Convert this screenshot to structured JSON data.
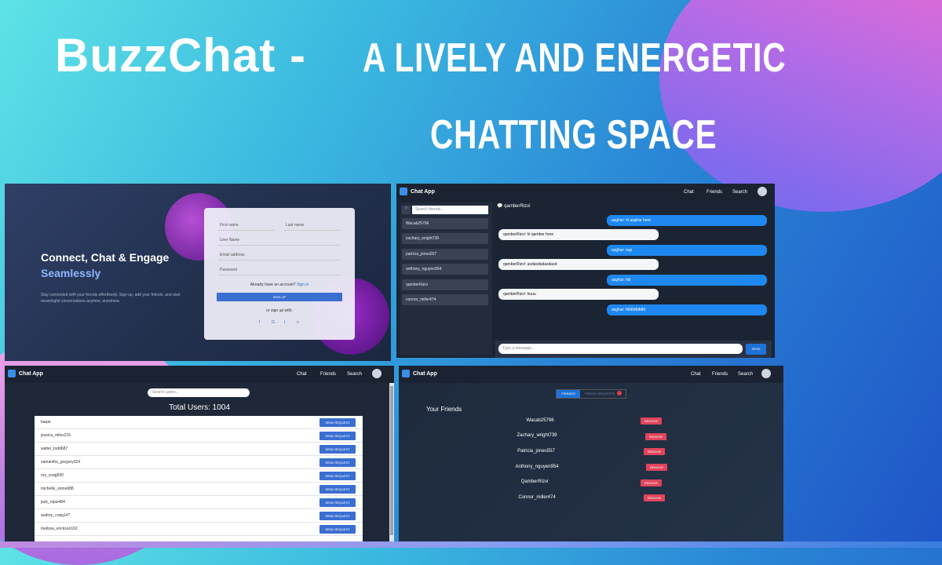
{
  "hero": {
    "brand": "BuzzChat  -",
    "line1": "A LIVELY AND ENERGETIC",
    "line2": "CHATTING SPACE"
  },
  "signup": {
    "heading": "Connect, Chat & Engage",
    "subheading": "Seamlessly",
    "description": "Stay connected with your friends effortlessly. Sign up, add your friends, and start meaningful conversations anytime, anywhere.",
    "first_name": "First name",
    "last_name": "Last name",
    "username": "User Name",
    "email": "Email address",
    "password": "Password",
    "account_prompt": "Already have an account?",
    "sign_in": "Sign in",
    "signup_button": "SIGN UP",
    "or_sign_up": "or sign up with:",
    "social_icons": [
      "facebook-icon",
      "google-icon",
      "twitter-icon",
      "github-icon"
    ]
  },
  "nav": {
    "brand": "Chat App",
    "chat": "Chat",
    "friends": "Friends",
    "search": "Search"
  },
  "chat": {
    "search_placeholder": "Search friends...",
    "friends": [
      "Wacab25796",
      "zachary_wright739",
      "patricia_jones557",
      "anthony_nguyen954",
      "qamberRizvi",
      "connor_miller474"
    ],
    "header": "qamberRizvi",
    "messages": [
      {
        "side": "right",
        "text": "asghar: hi asghar here"
      },
      {
        "side": "left",
        "text": "qamberRizvi: hi qamber here"
      },
      {
        "side": "right",
        "text": "asghar: sup"
      },
      {
        "side": "left",
        "text": "qamberRizvi: asdasdadasdasd"
      },
      {
        "side": "right",
        "text": "asghar: hiii"
      },
      {
        "side": "left",
        "text": "qamberRizvi: huuu"
      },
      {
        "side": "right",
        "text": "asghar: fdfdfdfdfdfd"
      }
    ],
    "input_placeholder": "Type a message...",
    "send": "SEND"
  },
  "users": {
    "search_placeholder": "Search users...",
    "total": "Total Users: 1004",
    "button": "SEND REQUEST",
    "list": [
      "baqar",
      "jessica_miles215",
      "walter_todd687",
      "samantha_gregory524",
      "roy_craig830",
      "michelle_stone688",
      "jack_rojas484",
      "audrey_craig147",
      "melissa_erickson162"
    ]
  },
  "friends_page": {
    "tab_friends": "FRIENDS",
    "tab_requests": "FRIEND REQUESTS",
    "heading": "Your Friends",
    "remove": "REMOVE",
    "list": [
      "Wacab25796",
      "Zachary_wright739",
      "Patricia_jones557",
      "Anthony_nguyen954",
      "QamberRizvi",
      "Connor_miller474"
    ]
  }
}
